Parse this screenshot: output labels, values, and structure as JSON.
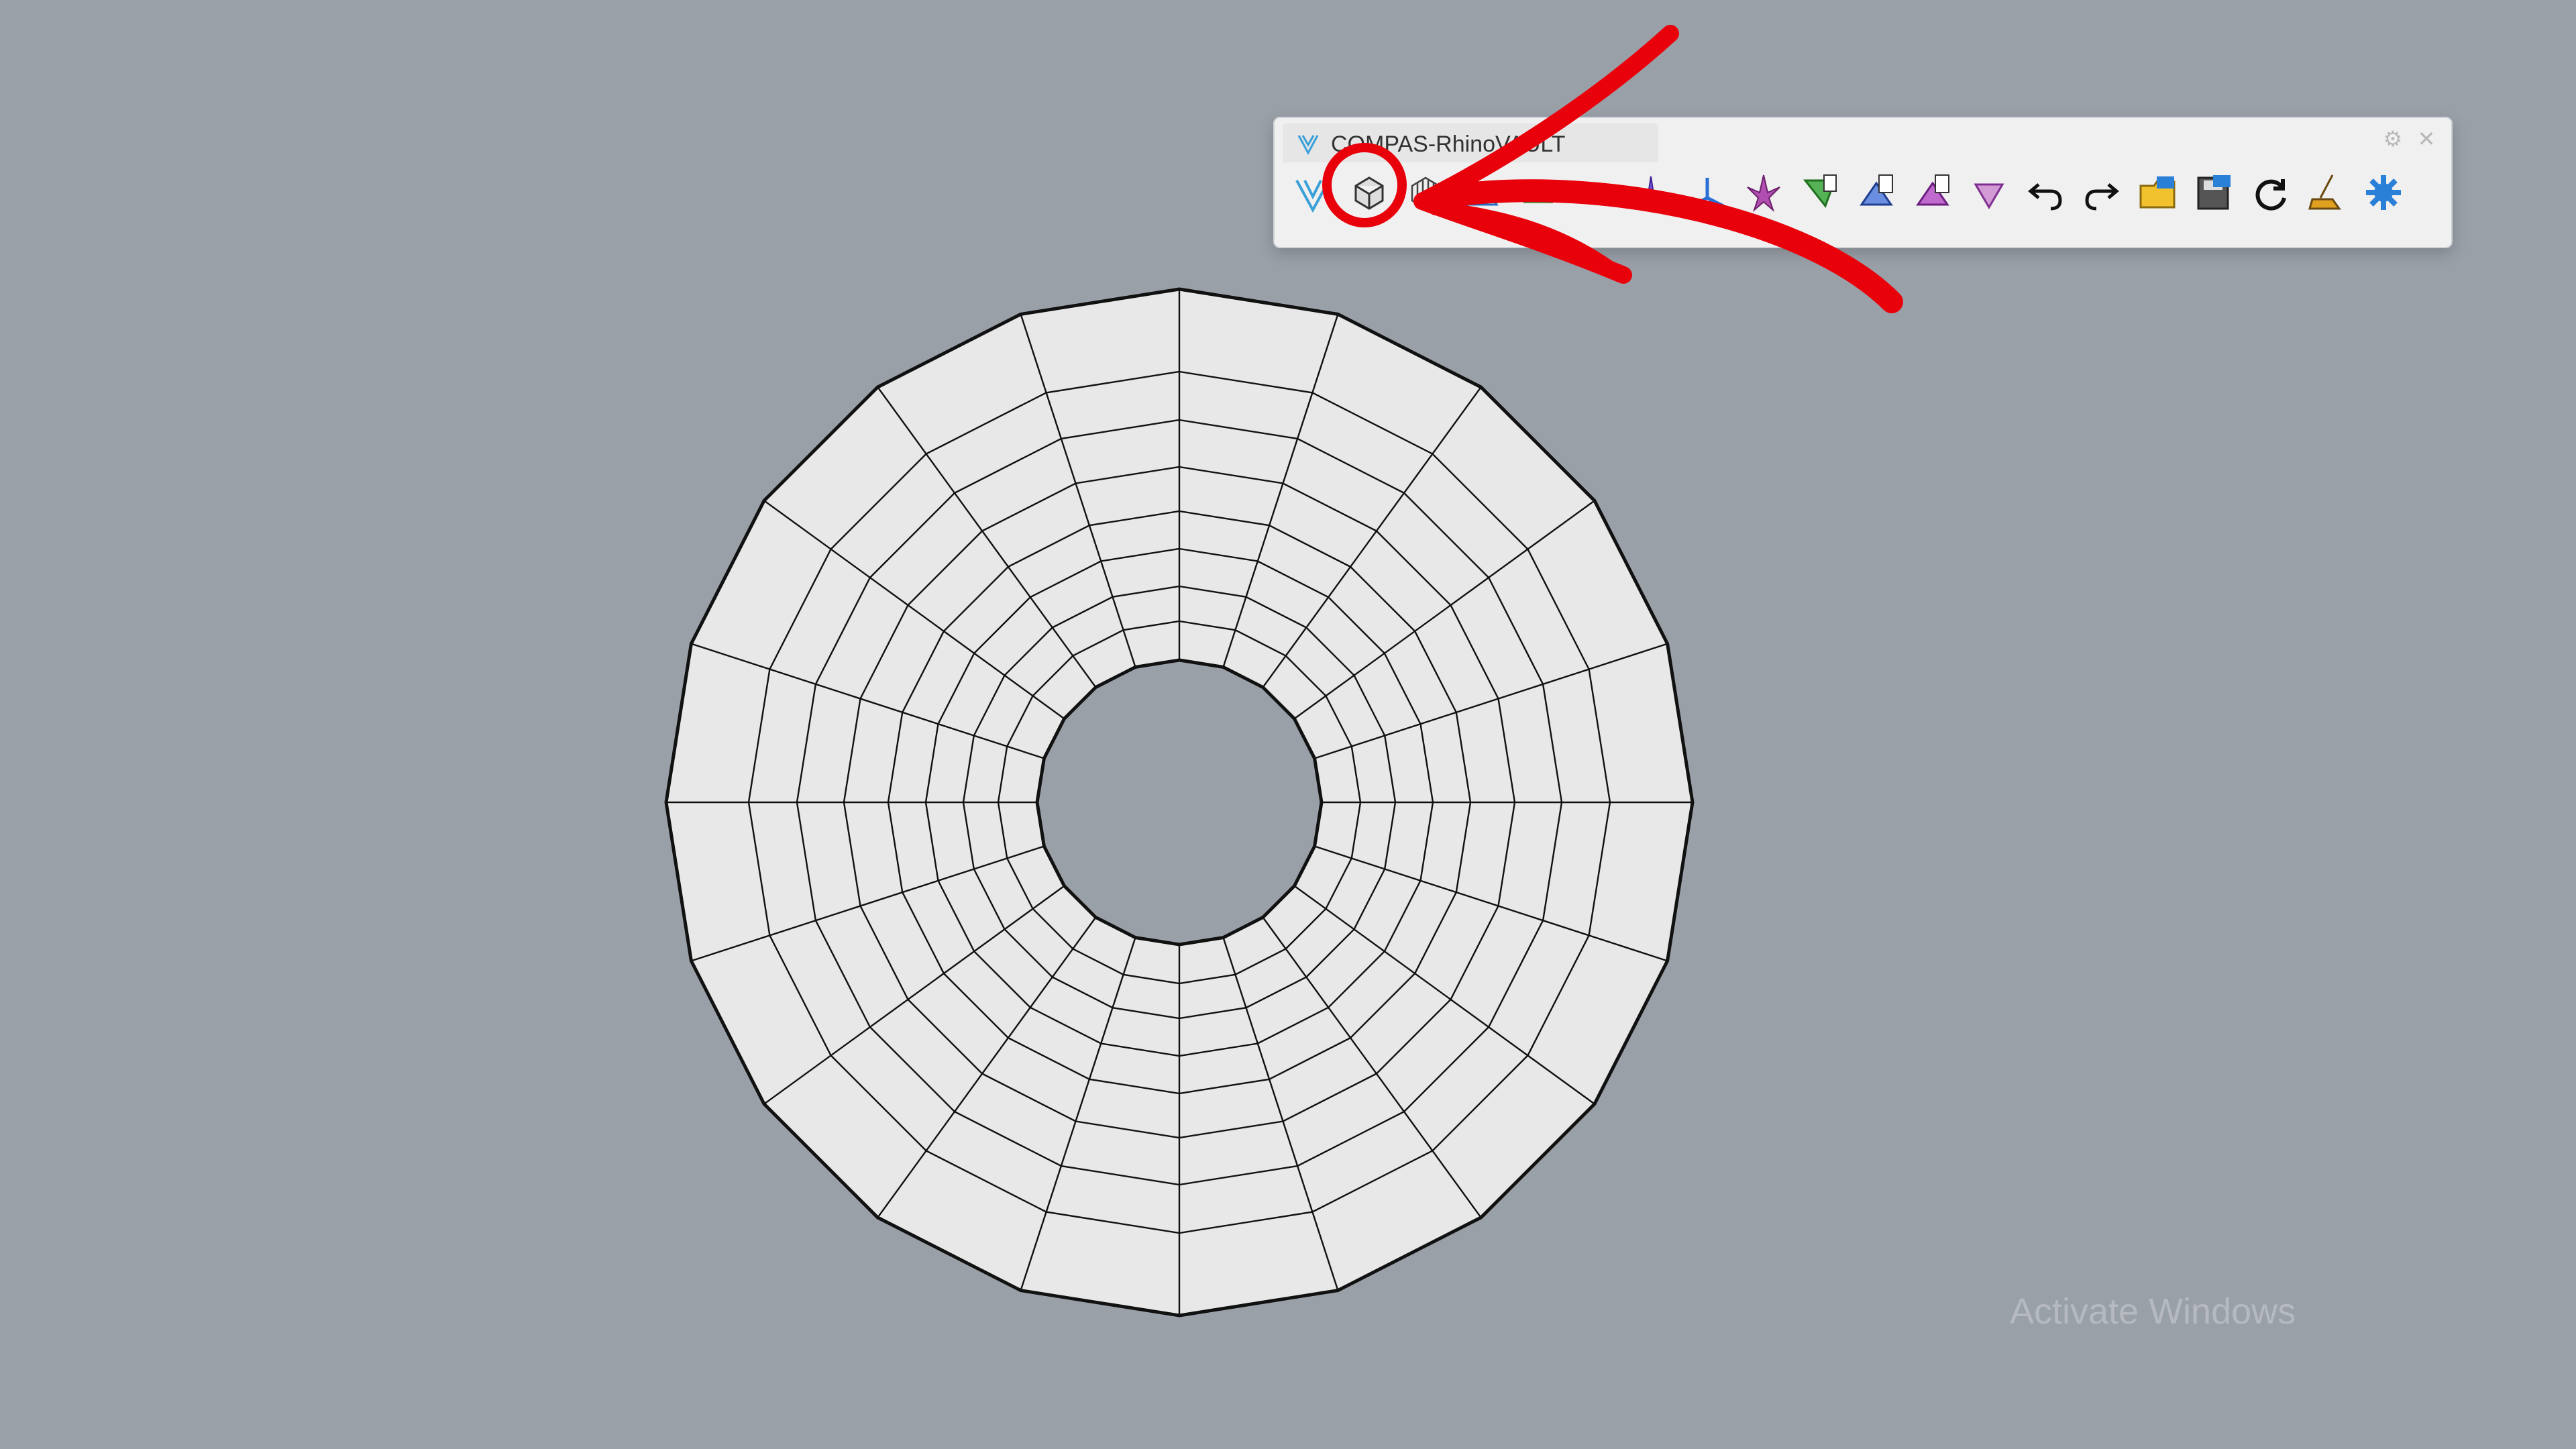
{
  "window": {
    "background": "#9aa0a8"
  },
  "toolbar": {
    "title": "COMPAS-RhinoVAULT",
    "settings_glyph": "⚙",
    "close_glyph": "✕",
    "tools": [
      {
        "icon": "rhinovault-logo-icon"
      },
      {
        "icon": "form-from-mesh-icon",
        "highlighted": true
      },
      {
        "icon": "form-from-lines-icon"
      },
      {
        "icon": "boundary-icon"
      },
      {
        "icon": "supports-icon"
      },
      {
        "icon": "form-diagram-icon"
      },
      {
        "icon": "thrust-diagram-icon"
      },
      {
        "icon": "force-diagram-icon"
      },
      {
        "icon": "horizontal-equilibrium-icon"
      },
      {
        "icon": "vertical-equilibrium-icon"
      },
      {
        "icon": "modify-form-icon"
      },
      {
        "icon": "modify-force-icon"
      },
      {
        "icon": "modify-thrust-icon"
      },
      {
        "icon": "undo-icon"
      },
      {
        "icon": "redo-icon"
      },
      {
        "icon": "open-rv-file-icon"
      },
      {
        "icon": "save-rv-file-icon"
      },
      {
        "icon": "reload-icon"
      },
      {
        "icon": "clear-icon"
      },
      {
        "icon": "settings-gear-icon"
      }
    ]
  },
  "mesh": {
    "fill": "#e8e8e8",
    "stroke": "#111111"
  },
  "annotation": {
    "color": "#e8000b"
  },
  "watermark": {
    "text": "Activate Windows"
  }
}
